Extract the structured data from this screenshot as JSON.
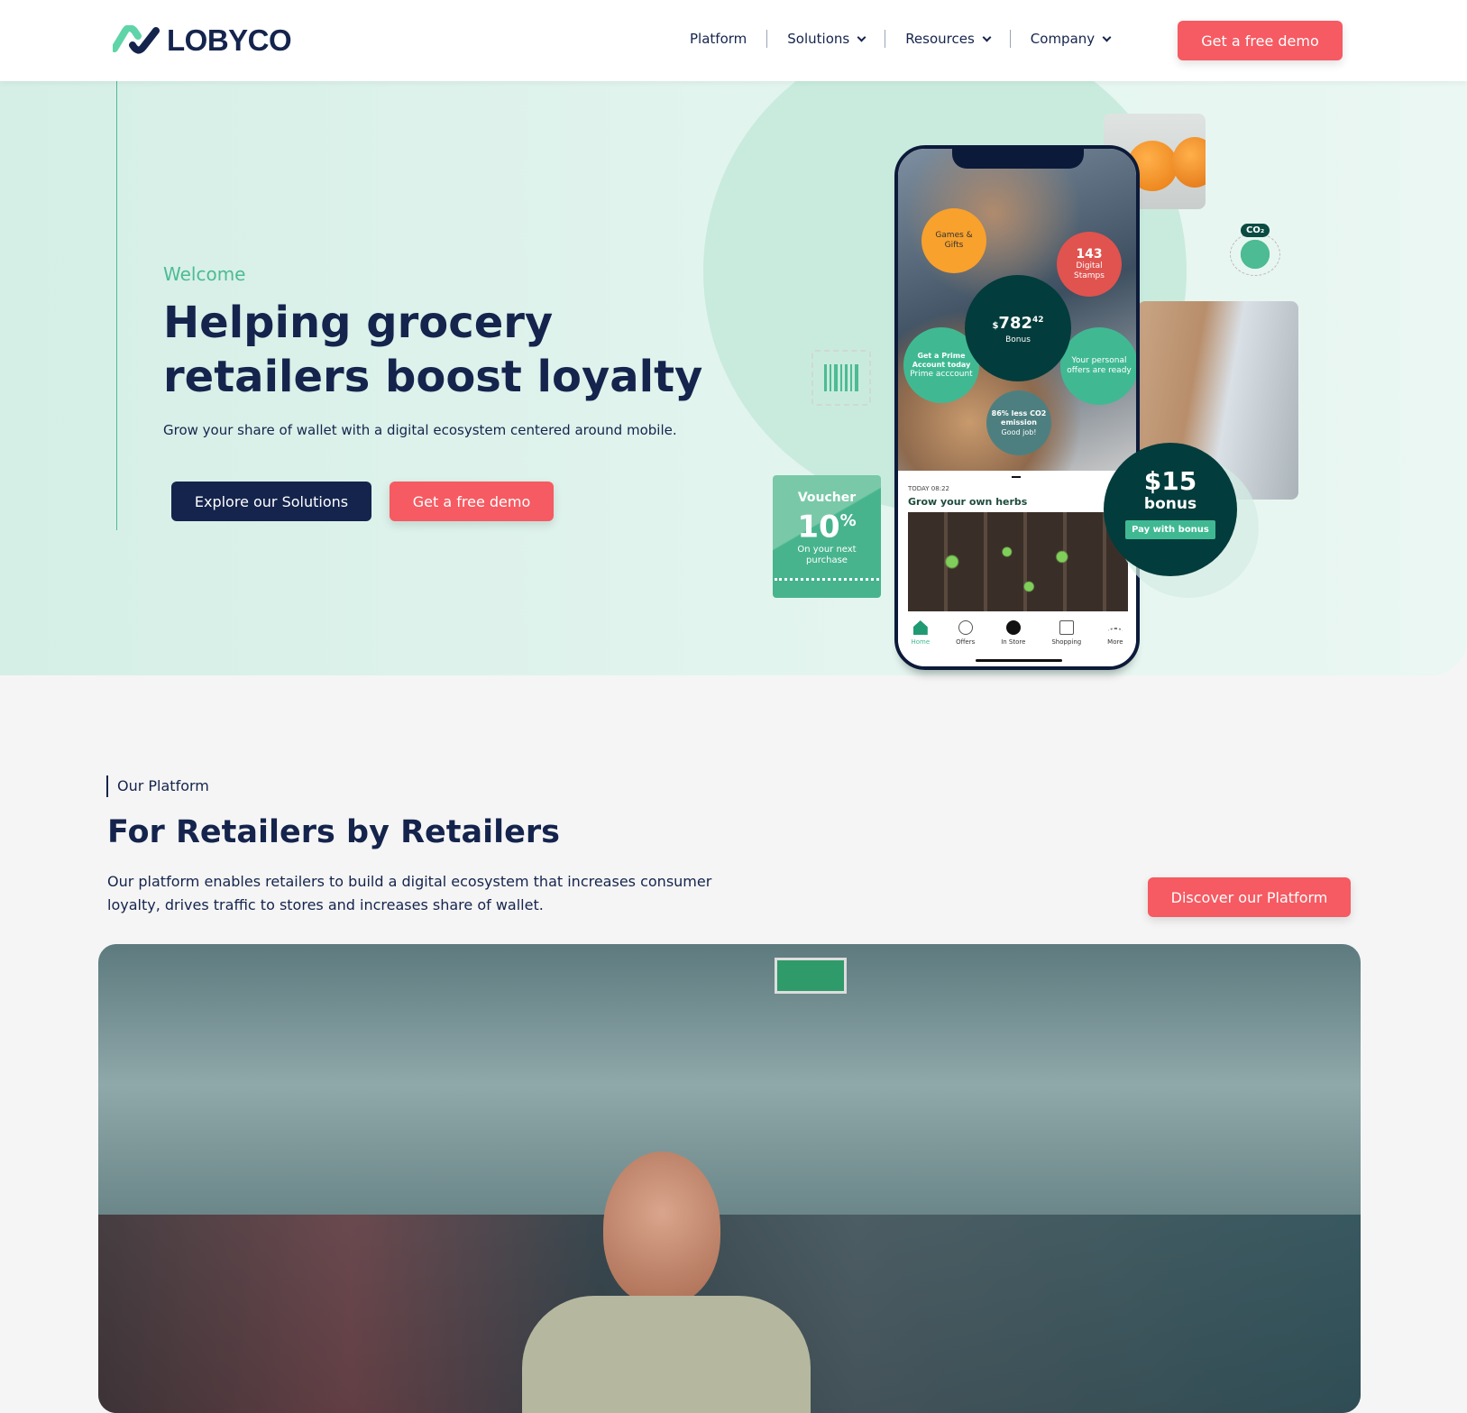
{
  "header": {
    "logo": "LOBYCO",
    "nav": [
      {
        "label": "Platform",
        "dropdown": false
      },
      {
        "label": "Solutions",
        "dropdown": true
      },
      {
        "label": "Resources",
        "dropdown": true
      },
      {
        "label": "Company",
        "dropdown": true
      }
    ],
    "cta": "Get a free demo"
  },
  "hero": {
    "eyebrow": "Welcome",
    "title": "Helping grocery retailers boost loyalty",
    "subtitle": "Grow your share of wallet with a digital ecosystem centered around mobile.",
    "primary_button": "Explore our Solutions",
    "secondary_button": "Get a free demo"
  },
  "phone": {
    "games": "Games & Gifts",
    "stamps_count": "143",
    "stamps_label": "Digital Stamps",
    "bonus_currency": "$",
    "bonus_amount": "782",
    "bonus_cents": "42",
    "bonus_label": "Bonus",
    "prime_title": "Get a Prime Account today",
    "prime_sub": "Prime acccount",
    "offers": "Your personal offers are ready",
    "co2": "86% less CO2 emission",
    "co2_sub": "Good job!",
    "card_time": "TODAY 08:22",
    "card_title": "Grow your own herbs",
    "tabs": [
      "Home",
      "Offers",
      "In Store",
      "Shopping",
      "More"
    ]
  },
  "voucher": {
    "title": "Voucher",
    "value": "10",
    "unit": "%",
    "sub": "On your next purchase"
  },
  "bonus_badge": {
    "amount": "$15",
    "label": "bonus",
    "button": "Pay with bonus"
  },
  "co2_badge": "CO₂",
  "platform": {
    "label": "Our Platform",
    "title": "For Retailers by Retailers",
    "text": "Our platform enables retailers to build a digital ecosystem that increases consumer loyalty, drives traffic to stores and increases share of wallet.",
    "button": "Discover our Platform"
  },
  "colors": {
    "navy": "#15244d",
    "coral": "#f65a62",
    "green": "#4dbb93",
    "dark_teal": "#033c3c"
  }
}
